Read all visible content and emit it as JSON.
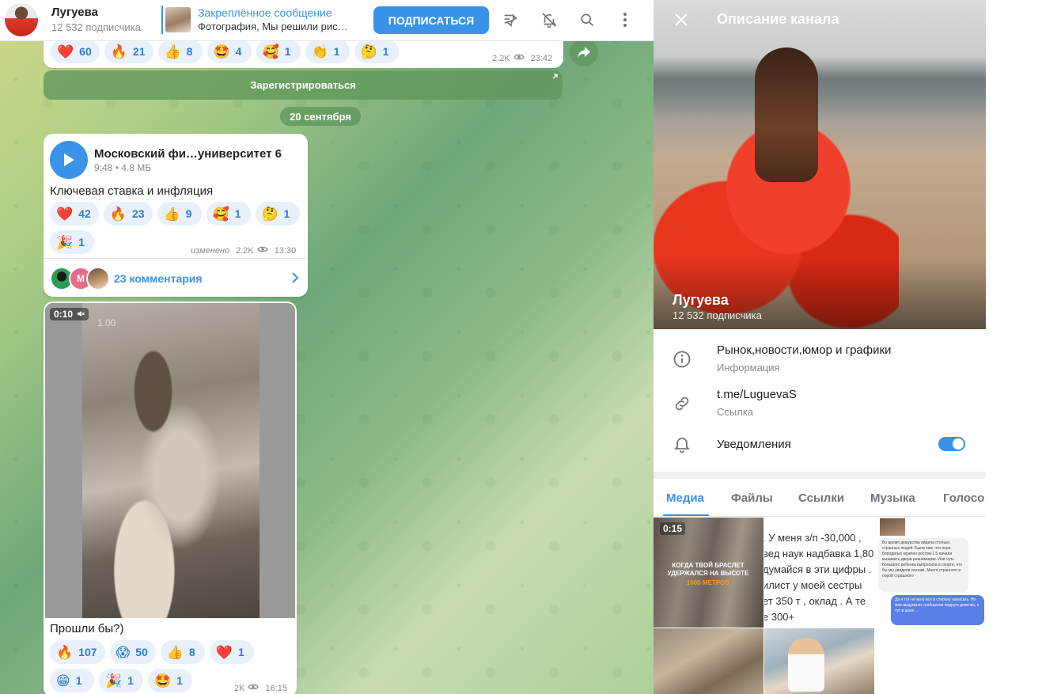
{
  "header": {
    "channel_name": "Лугуева",
    "subscribers": "12 532 подписчика",
    "pinned_title": "Закреплённое сообщение",
    "pinned_text": "Фотография, Мы решили рис…",
    "subscribe_label": "ПОДПИСАТЬСЯ"
  },
  "messages": {
    "top": {
      "reactions": [
        {
          "emoji": "❤️",
          "count": "60"
        },
        {
          "emoji": "🔥",
          "count": "21"
        },
        {
          "emoji": "👍",
          "count": "8"
        },
        {
          "emoji": "🤩",
          "count": "4"
        },
        {
          "emoji": "🥰",
          "count": "1"
        },
        {
          "emoji": "👏",
          "count": "1"
        },
        {
          "emoji": "🤔",
          "count": "1"
        }
      ],
      "views": "2.2K",
      "time": "23:42"
    },
    "register_button": "Зарегистрироваться",
    "date_divider": "20 сентября",
    "audio": {
      "title": "Московский фи…университет 6",
      "meta": "9:48 • 4.8 MБ",
      "text": "Ключевая ставка и инфляция",
      "reactions": [
        {
          "emoji": "❤️",
          "count": "42"
        },
        {
          "emoji": "🔥",
          "count": "23"
        },
        {
          "emoji": "👍",
          "count": "9"
        },
        {
          "emoji": "🥰",
          "count": "1"
        },
        {
          "emoji": "🤔",
          "count": "1"
        },
        {
          "emoji": "🎉",
          "count": "1"
        }
      ],
      "edited": "изменено",
      "views": "2.2K",
      "time": "13:30",
      "comment_avatar_letter": "М",
      "comments": "23 комментария"
    },
    "video": {
      "duration": "0:10",
      "speed": "1.00",
      "text": "Прошли бы?)",
      "reactions": [
        {
          "emoji": "🔥",
          "count": "107"
        },
        {
          "emoji": "😱",
          "count": "50"
        },
        {
          "emoji": "👍",
          "count": "8"
        },
        {
          "emoji": "❤️",
          "count": "1"
        },
        {
          "emoji": "😁",
          "count": "1"
        },
        {
          "emoji": "🎉",
          "count": "1"
        },
        {
          "emoji": "🤩",
          "count": "1"
        }
      ],
      "views": "2K",
      "time": "16:15"
    }
  },
  "panel": {
    "header_title": "Описание канала",
    "name": "Лугуева",
    "subscribers": "12 532 подписчика",
    "description": "Рынок,новости,юмор и графики",
    "description_label": "Информация",
    "link": "t.me/LuguevaS",
    "link_label": "Ссылка",
    "notifications_label": "Уведомления",
    "notifications_on": true,
    "tabs": [
      "Медиа",
      "Файлы",
      "Ссылки",
      "Музыка",
      "Голосо"
    ],
    "media": {
      "video_duration": "0:15",
      "video_caption_1": "КОГДА ТВОЙ БРАСЛЕТ УДЕРЖАЛСЯ НА ВЫСОТЕ",
      "video_caption_2": "1000 МЕТРОВ",
      "text_snippet": ". У меня з/п -30,000 , \nвед наук надбавка 1,80\nдумайся в эти цифры .\nилист у моей сестры\nет 350 т , оклад . А те\nе 300+",
      "chat_received": "Во время дежурства видела столько странных людей. Была там, что пора бородатых мужчин ростом 1.5 начали вызывать двери реанимации. Или чуть большого ребенка выпросила в спорте, что бы мы увидели похоже. Много странного и порой страшного",
      "chat_sent": "Да я тут не могу все в сторону написать. Но мне выдумали сообщение подруге девочки, я тут в шоке…"
    }
  }
}
